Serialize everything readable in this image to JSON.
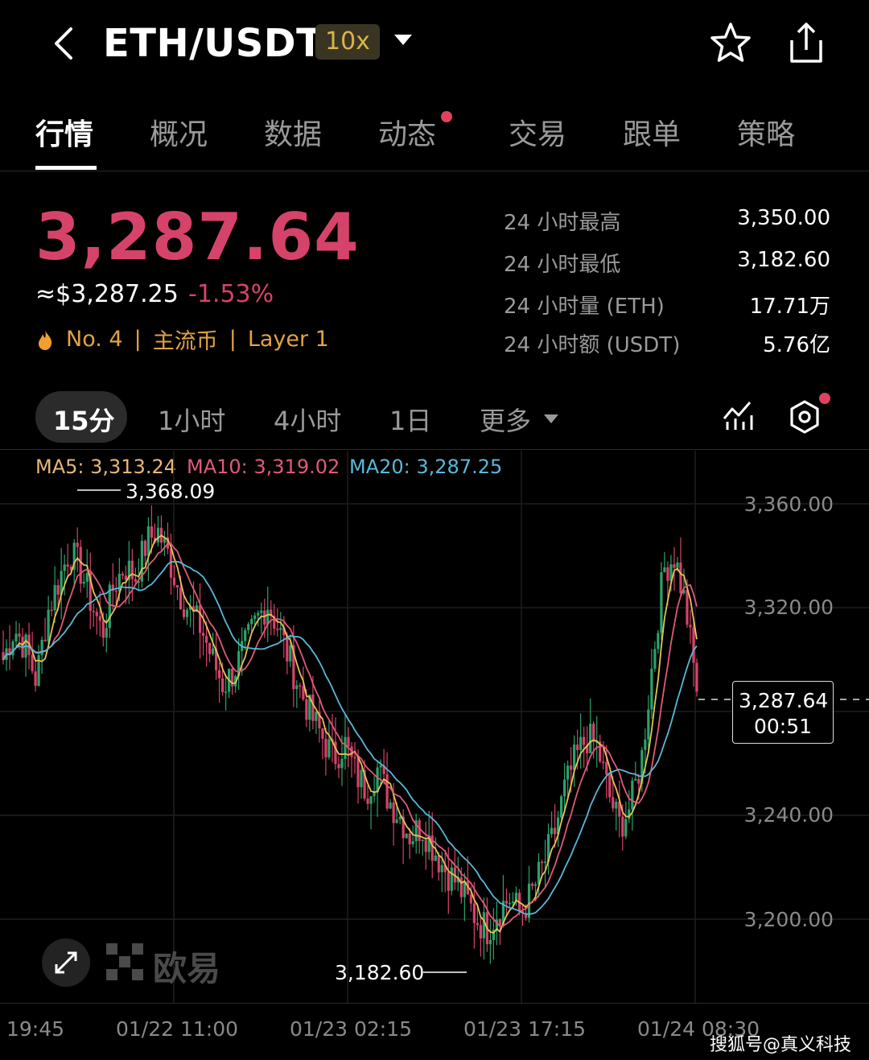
{
  "header": {
    "pair": "ETH/USDT",
    "leverage": "10x"
  },
  "tabs": [
    "行情",
    "概况",
    "数据",
    "动态",
    "交易",
    "跟单",
    "策略"
  ],
  "quote": {
    "price": "3,287.64",
    "approx_usd": "≈$3,287.25",
    "change": "-1.53%",
    "rank": "No. 4",
    "tag1": "主流币",
    "tag2": "Layer 1",
    "stats": [
      {
        "label": "24 小时最高",
        "value": "3,350.00"
      },
      {
        "label": "24 小时最低",
        "value": "3,182.60"
      },
      {
        "label": "24 小时量 (ETH)",
        "value": "17.71万"
      },
      {
        "label": "24 小时额 (USDT)",
        "value": "5.76亿"
      }
    ]
  },
  "timeframes": [
    "15分",
    "1小时",
    "4小时",
    "1日",
    "更多"
  ],
  "indicators": {
    "ma5": "MA5: 3,313.24",
    "ma10": "MA10: 3,319.02",
    "ma20": "MA20: 3,287.25"
  },
  "colors": {
    "up": "#2aa36a",
    "down": "#d6436a",
    "ma5": "#e8c15a",
    "ma10": "#e05a7a",
    "ma20": "#5ab8d8"
  },
  "chart_data": {
    "type": "candlestick",
    "y_axis_labels": [
      "3,360.00",
      "3,320.00",
      "3,240.00",
      "3,200.00"
    ],
    "x_axis_labels": [
      "19:45",
      "01/22 11:00",
      "01/23 02:15",
      "01/23 17:15",
      "01/24 08:30"
    ],
    "ylim": [
      3170,
      3390
    ],
    "high_marker": "3,368.09",
    "low_marker": "3,182.60",
    "current_price": "3,287.64",
    "countdown": "00:51",
    "close_path": [
      3300,
      3312,
      3305,
      3292,
      3318,
      3330,
      3342,
      3335,
      3322,
      3310,
      3328,
      3336,
      3332,
      3345,
      3350,
      3340,
      3326,
      3318,
      3312,
      3300,
      3290,
      3296,
      3305,
      3315,
      3322,
      3312,
      3300,
      3288,
      3278,
      3270,
      3262,
      3268,
      3256,
      3250,
      3258,
      3246,
      3240,
      3232,
      3236,
      3228,
      3220,
      3215,
      3208,
      3200,
      3196,
      3204,
      3208,
      3202,
      3210,
      3220,
      3232,
      3250,
      3262,
      3270,
      3266,
      3248,
      3236,
      3244,
      3262,
      3300,
      3335,
      3340,
      3320,
      3288
    ]
  },
  "brand": {
    "logo_text": "欧易"
  },
  "watermark": "搜狐号@真义科技"
}
